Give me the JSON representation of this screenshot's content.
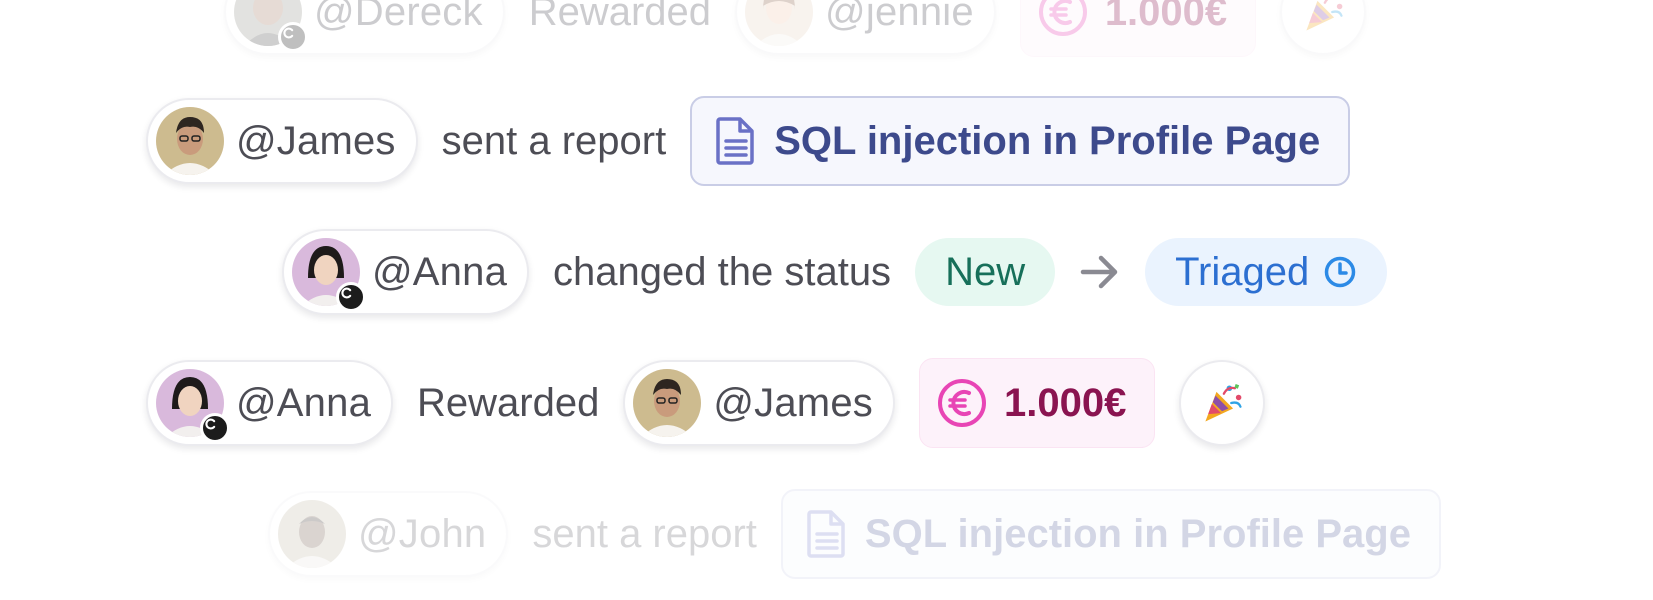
{
  "feed": {
    "row_top": {
      "user": "@Dereck",
      "action": "Rewarded",
      "recipient": "@jennie",
      "amount": "1.000€"
    },
    "row_report": {
      "user": "@James",
      "action": "sent a report",
      "report_title": "SQL injection in Profile Page",
      "report_icon": "document-icon"
    },
    "row_status": {
      "user": "@Anna",
      "action": "changed the status",
      "from_status": "New",
      "to_status": "Triaged",
      "to_status_icon": "clock-icon"
    },
    "row_reward": {
      "user": "@Anna",
      "action": "Rewarded",
      "recipient": "@James",
      "amount": "1.000€",
      "currency_icon": "euro-icon",
      "celebration_icon": "party-popper-icon"
    },
    "row_bottom": {
      "user": "@John",
      "action": "sent a report",
      "report_title": "SQL injection in Profile Page"
    }
  },
  "colors": {
    "report_accent": "#3d4a8c",
    "new_status": "#17705a",
    "triaged_status": "#2c6fd1",
    "reward_accent": "#e845b5",
    "reward_amount": "#8a1450"
  }
}
